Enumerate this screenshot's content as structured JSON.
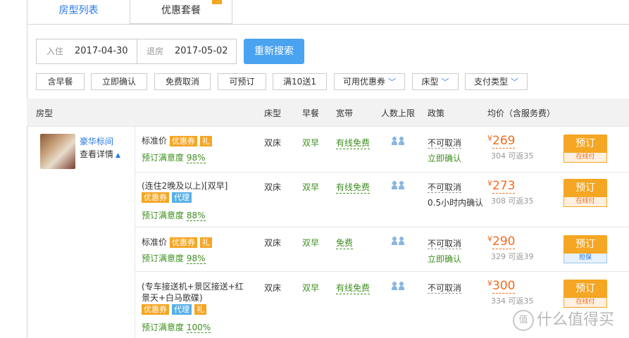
{
  "tabs": [
    {
      "label": "房型列表",
      "active": true
    },
    {
      "label": "优惠套餐",
      "active": false
    }
  ],
  "search": {
    "checkin_label": "入住",
    "checkin_value": "2017-04-30",
    "checkout_label": "退房",
    "checkout_value": "2017-05-02",
    "button_label": "重新搜索"
  },
  "filters": [
    {
      "label": "含早餐"
    },
    {
      "label": "立即确认"
    },
    {
      "label": "免费取消"
    },
    {
      "label": "可预订"
    },
    {
      "label": "满10送1"
    },
    {
      "label": "可用优惠券"
    },
    {
      "label": "床型"
    },
    {
      "label": "支付类型"
    }
  ],
  "table_headers": {
    "room": "房型",
    "bed": "床型",
    "breakfast": "早餐",
    "broadband": "宽带",
    "capacity": "人数上限",
    "policy": "政策",
    "price": "均价（含服务费）"
  },
  "room": {
    "name": "豪华标间",
    "detail_label": "查看详情"
  },
  "plans": [
    {
      "name": "标准价",
      "tags": [
        "优惠券",
        "礼"
      ],
      "satisfaction_label": "预订满意度",
      "satisfaction": "98%",
      "bed": "双床",
      "breakfast": "双早",
      "broadband": "有线免费",
      "policy": "不可取消",
      "policy_sub": "立即确认",
      "price": "269",
      "currency": "¥",
      "original": "304 可返35",
      "book_label": "预订",
      "pay_label": "在线付"
    },
    {
      "name": "(连住2晚及以上)[双早]",
      "tags": [
        "优惠券",
        "代理"
      ],
      "satisfaction_label": "预订满意度",
      "satisfaction": "88%",
      "bed": "双床",
      "breakfast": "双早",
      "broadband": "有线免费",
      "policy": "不可取消",
      "policy_sub": "0.5小时内确认",
      "price": "273",
      "currency": "¥",
      "original": "308 可返35",
      "book_label": "预订",
      "pay_label": "在线付"
    },
    {
      "name": "标准价",
      "tags": [
        "优惠券",
        "礼"
      ],
      "satisfaction_label": "预订满意度",
      "satisfaction": "98%",
      "bed": "双床",
      "breakfast": "双早",
      "broadband": "免费",
      "policy": "不可取消",
      "policy_sub": "立即确认",
      "price": "290",
      "currency": "¥",
      "original": "329 可返39",
      "book_label": "预订",
      "pay_label": "担保"
    },
    {
      "name_line1": "(专车接送机+景区接送+红",
      "name_line2": "景天+白马歌碟)",
      "tags": [
        "优惠券",
        "代理",
        "礼"
      ],
      "satisfaction_label": "预订满意度",
      "satisfaction": "100%",
      "bed": "双床",
      "breakfast": "双早",
      "broadband": "有线免费",
      "policy": "不可取消",
      "price": "300",
      "currency": "¥",
      "original": "334 可返35",
      "book_label": "预订",
      "pay_label": "在线付"
    }
  ],
  "watermark": {
    "badge": "值",
    "text": "什么值得买"
  }
}
